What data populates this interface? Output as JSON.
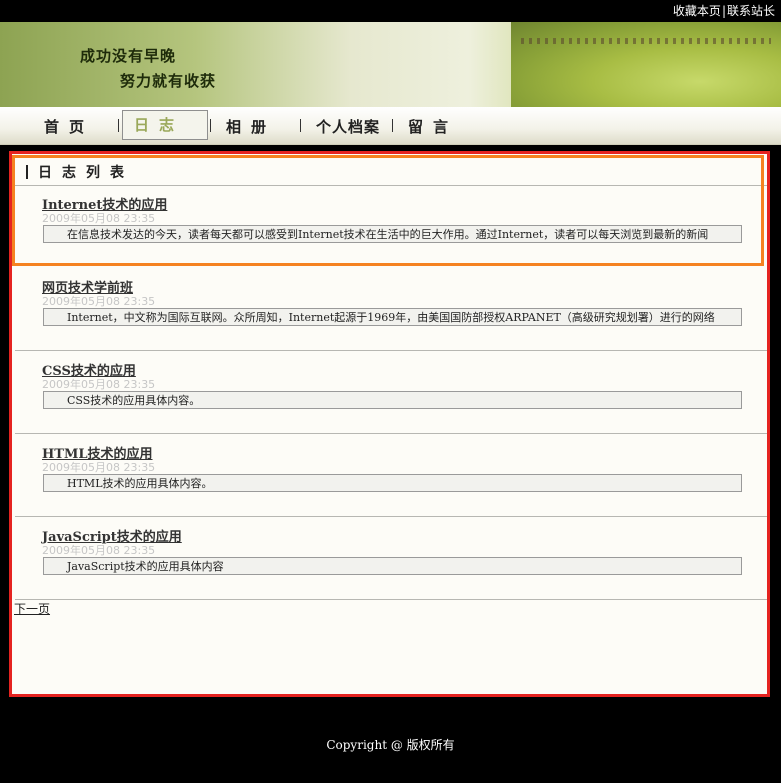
{
  "topbar": {
    "bookmark": "收藏本页",
    "separator": "|",
    "contact": "联系站长"
  },
  "header": {
    "slogan_line1": "成功没有早晚",
    "slogan_line2": "努力就有收获"
  },
  "nav": {
    "items": [
      {
        "label": "首页"
      },
      {
        "label": "日志",
        "active": true
      },
      {
        "label": "相册"
      },
      {
        "label": "个人档案"
      },
      {
        "label": "留言"
      }
    ],
    "colors": {
      "active_text": "#9aa85a"
    }
  },
  "blog": {
    "list_title": "日志列表",
    "posts": [
      {
        "title": "Internet技术的应用",
        "date": "2009年05月08 23:35",
        "summary": "在信息技术发达的今天，读者每天都可以感受到Internet技术在生活中的巨大作用。通过Internet，读者可以每天浏览到最新的新闻"
      },
      {
        "title": "网页技术学前班",
        "date": "2009年05月08 23:35",
        "summary": "Internet，中文称为国际互联网。众所周知，Internet起源于1969年，由美国国防部授权ARPANET（高级研究规划署）进行的网络"
      },
      {
        "title": "CSS技术的应用",
        "date": "2009年05月08 23:35",
        "summary": "CSS技术的应用具体内容。"
      },
      {
        "title": "HTML技术的应用",
        "date": "2009年05月08 23:35",
        "summary": "HTML技术的应用具体内容。"
      },
      {
        "title": "JavaScript技术的应用",
        "date": "2009年05月08 23:35",
        "summary": "JavaScript技术的应用具体内容"
      }
    ],
    "next_page": "下一页"
  },
  "footer": {
    "copyright": "Copyright @ 版权所有"
  },
  "colors": {
    "highlight_red": "#e52320",
    "highlight_orange": "#f58220"
  }
}
